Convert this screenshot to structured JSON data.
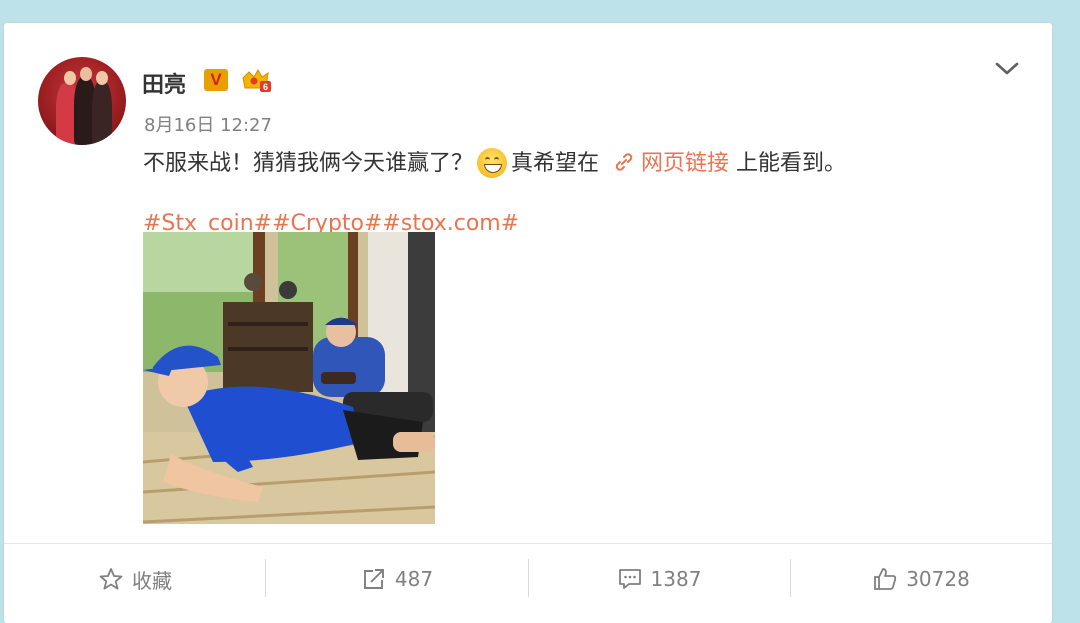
{
  "post": {
    "username": "田亮",
    "verified_badge": "V",
    "timestamp": "8月16日 12:27",
    "text_before_emoji": "不服来战！猜猜我俩今天谁赢了？",
    "emoji": "grinning-face",
    "text_after_emoji": "真希望在",
    "link_label": "网页链接",
    "text_after_link": "上能看到。",
    "hashtags": "#Stx_coin##Crypto##stox.com#"
  },
  "actions": {
    "favorite_label": "收藏",
    "repost_count": "487",
    "comment_count": "1387",
    "like_count": "30728"
  },
  "colors": {
    "background": "#bde2ea",
    "link": "#eb7350",
    "text": "#333333",
    "muted": "#808080"
  },
  "icons": [
    "chevron-down-icon",
    "link-icon",
    "star-icon",
    "share-icon",
    "comment-icon",
    "thumbs-up-icon"
  ]
}
